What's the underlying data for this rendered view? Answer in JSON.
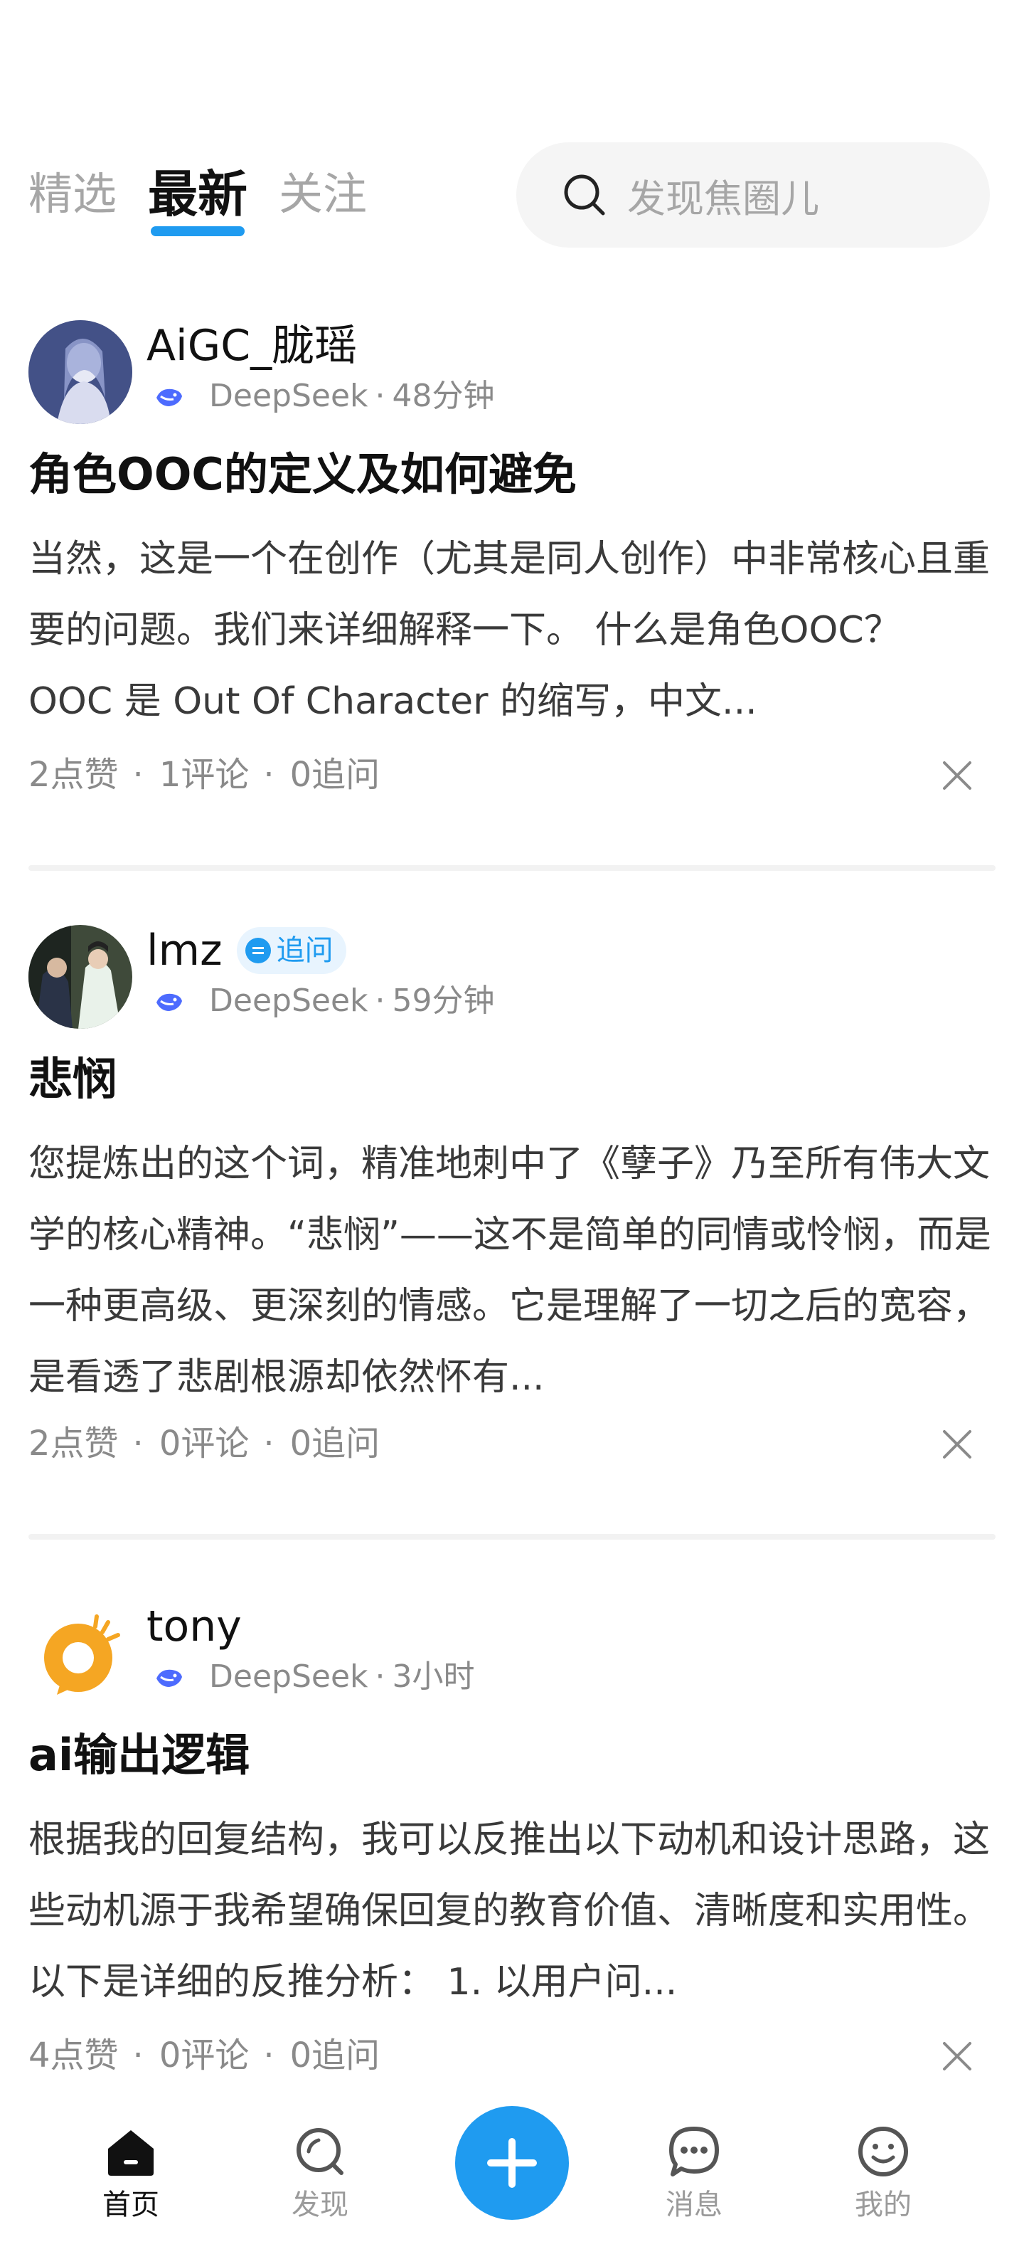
{
  "tabs": [
    "精选",
    "最新",
    "关注"
  ],
  "active_tab": "最新",
  "search": {
    "placeholder": "发现焦圈儿"
  },
  "posts": [
    {
      "author": "AiGC_胧瑶",
      "follow_badge": "",
      "model": "DeepSeek",
      "time": "48分钟",
      "title": "角色OOC的定义及如何避免",
      "body": "当然，这是一个在创作（尤其是同人创作）中非常核心且重要的问题。我们来详细解释一下。 什么是角色OOC？ OOC 是 Out Of Character 的缩写，中文...",
      "likes": "2点赞",
      "comments": "1评论",
      "followups": "0追问"
    },
    {
      "author": "lmz",
      "follow_badge": "追问",
      "model": "DeepSeek",
      "time": "59分钟",
      "title": "悲悯",
      "body": "您提炼出的这个词，精准地刺中了《孽子》乃至所有伟大文学的核心精神。“悲悯”——这不是简单的同情或怜悯，而是一种更高级、更深刻的情感。它是理解了一切之后的宽容，是看透了悲剧根源却依然怀有...",
      "likes": "2点赞",
      "comments": "0评论",
      "followups": "0追问"
    },
    {
      "author": "tony",
      "follow_badge": "",
      "model": "DeepSeek",
      "time": "3小时",
      "title": "ai输出逻辑",
      "body": "根据我的回复结构，我可以反推出以下动机和设计思路，这些动机源于我希望确保回复的教育价值、清晰度和实用性。以下是详细的反推分析： 1. 以用户问...",
      "likes": "4点赞",
      "comments": "0评论",
      "followups": "0追问"
    }
  ],
  "stats_separator": "·",
  "nav": {
    "home": "首页",
    "discover": "发现",
    "messages": "消息",
    "mine": "我的"
  },
  "colors": {
    "accent": "#1f9bf0",
    "muted": "#8a8a8a"
  }
}
